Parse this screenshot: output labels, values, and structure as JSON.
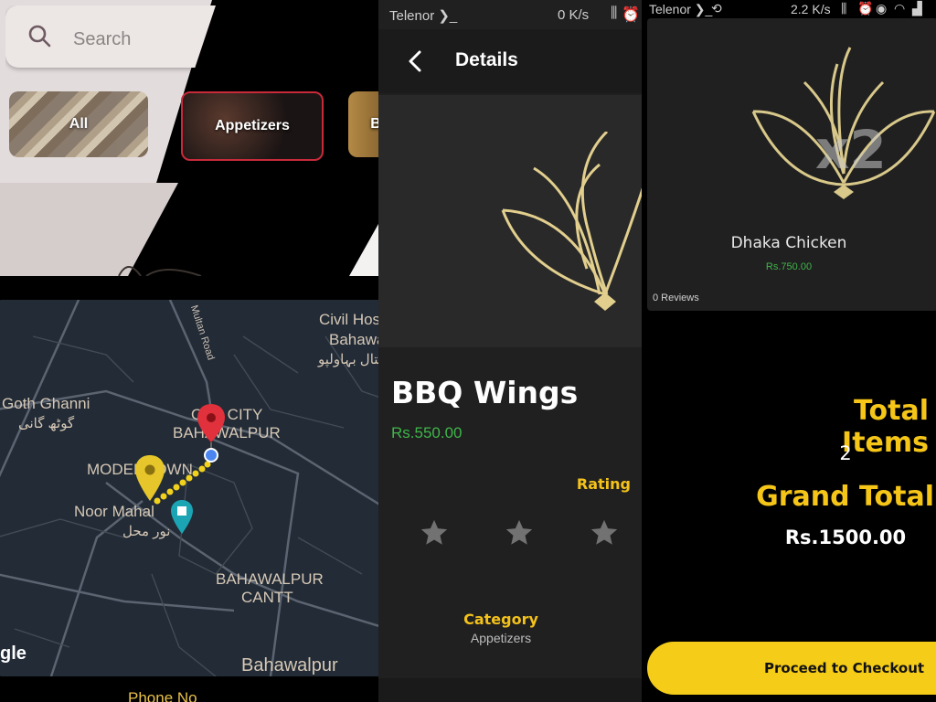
{
  "panel_search": {
    "search": {
      "placeholder": "Search"
    },
    "categories": [
      {
        "label": "All"
      },
      {
        "label": "Appetizers"
      },
      {
        "label": "B"
      }
    ]
  },
  "panel_map": {
    "labels": {
      "goth_ghanni": "Goth Ghanni",
      "goth_ghanni_ur": "گوٹھ گانی",
      "civil_hosp": "Civil Hos",
      "bahawa": "Bahawa",
      "civil_ur": "سپتال بہاولپو",
      "multan_road": "Multan Road",
      "old_city": "OLD CITY",
      "bahawalpur_city": "BAHAWALPUR",
      "model_town": "MODEL TOWN",
      "noor_mahal": "Noor Mahal",
      "noor_mahal_ur": "نور محل",
      "cantt_1": "BAHAWALPUR",
      "cantt_2": "CANTT",
      "bahawalpur": "Bahawalpur",
      "google": "gle"
    },
    "phone_label": "Phone No"
  },
  "panel_details": {
    "status": {
      "carrier": "Telenor ❯_",
      "speed": "0 K/s"
    },
    "header": {
      "title": "Details"
    },
    "dish": {
      "name": "BBQ Wings",
      "price": "Rs.550.00"
    },
    "rating_label": "Rating",
    "rating_value": 0,
    "category_label": "Category",
    "category_value": "Appetizers"
  },
  "panel_cart": {
    "status": {
      "carrier": "Telenor ❯_",
      "speed": "2.2 K/s"
    },
    "item": {
      "qty": "x2",
      "name": "Dhaka Chicken",
      "price": "Rs.750.00",
      "reviews": "0 Reviews"
    },
    "total_items_label": "Total Items",
    "total_items_value": "2",
    "grand_total_label": "Grand Total",
    "grand_total_value": "Rs.1500.00",
    "checkout_label": "Proceed to Checkout"
  },
  "colors": {
    "accent": "#f5c518",
    "price_green": "#3fb54a",
    "pin_red": "#e0313c",
    "pin_yellow": "#e6c62a",
    "route_yellow": "#f2d11d"
  }
}
